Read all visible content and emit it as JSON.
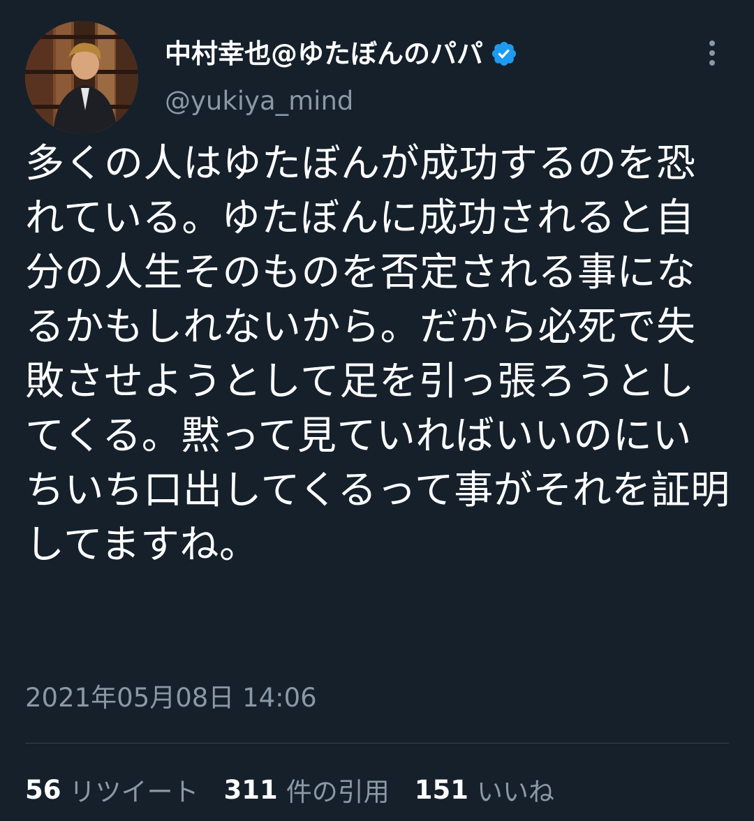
{
  "user": {
    "display_name": "中村幸也@ゆたぼんのパパ",
    "handle": "@yukiya_mind",
    "verified_icon": "verified-badge-icon",
    "avatar_icon": "avatar"
  },
  "menu": {
    "more_icon": "more-vertical-icon"
  },
  "tweet": {
    "text": "多くの人はゆたぼんが成功するのを恐れている。ゆたぼんに成功されると自分の人生そのものを否定される事になるかもしれないから。だから必死で失敗させようとして足を引っ張ろうとしてくる。黙って見ていればいいのにいちいち口出してくるって事がそれを証明してますね。",
    "timestamp": "2021年05月08日 14:06"
  },
  "stats": {
    "retweets": {
      "count": "56",
      "label": "リツイート"
    },
    "quotes": {
      "count": "311",
      "label": "件の引用"
    },
    "likes": {
      "count": "151",
      "label": "いいね"
    }
  },
  "colors": {
    "background": "#15202b",
    "text": "#ffffff",
    "secondary": "#8b98a5",
    "divider": "#38444d",
    "verified": "#1d9bf0"
  }
}
